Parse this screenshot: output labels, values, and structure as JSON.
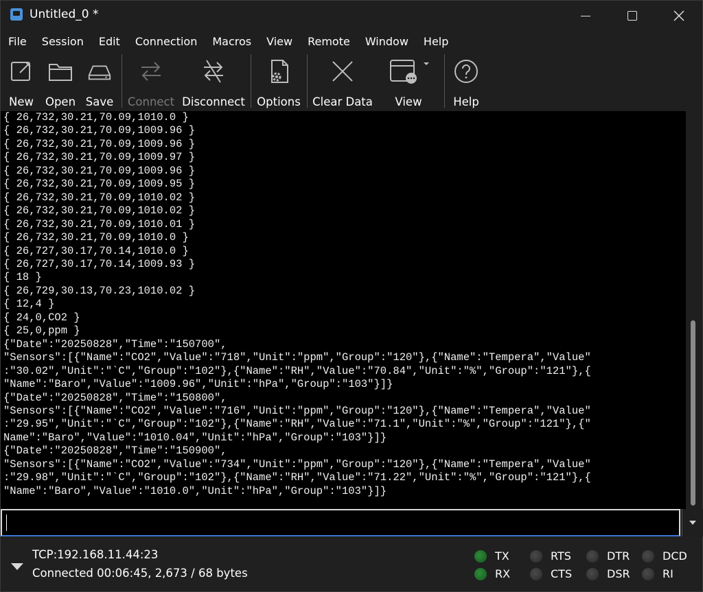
{
  "window": {
    "title": "Untitled_0 *"
  },
  "menu": [
    "File",
    "Session",
    "Edit",
    "Connection",
    "Macros",
    "View",
    "Remote",
    "Window",
    "Help"
  ],
  "toolbar": {
    "new": "New",
    "open": "Open",
    "save": "Save",
    "connect": "Connect",
    "disconnect": "Disconnect",
    "options": "Options",
    "clear": "Clear Data",
    "view": "View",
    "help": "Help"
  },
  "terminal": {
    "lines": [
      "{ 26,732,30.21,70.09,1010.0 }",
      "{ 26,732,30.21,70.09,1009.96 }",
      "{ 26,732,30.21,70.09,1009.96 }",
      "{ 26,732,30.21,70.09,1009.97 }",
      "{ 26,732,30.21,70.09,1009.96 }",
      "{ 26,732,30.21,70.09,1009.95 }",
      "{ 26,732,30.21,70.09,1010.02 }",
      "{ 26,732,30.21,70.09,1010.02 }",
      "{ 26,732,30.21,70.09,1010.01 }",
      "{ 26,732,30.21,70.09,1010.0 }",
      "{ 26,727,30.17,70.14,1010.0 }",
      "{ 26,727,30.17,70.14,1009.93 }",
      "{ 18 }",
      "{ 26,729,30.13,70.23,1010.02 }",
      "{ 12,4 }",
      "{ 24,0,CO2 }",
      "{ 25,0,ppm }",
      "{\"Date\":\"20250828\",\"Time\":\"150700\",",
      "\"Sensors\":[{\"Name\":\"CO2\",\"Value\":\"718\",\"Unit\":\"ppm\",\"Group\":\"120\"},{\"Name\":\"Tempera\",\"Value\"",
      ":\"30.02\",\"Unit\":\"`C\",\"Group\":\"102\"},{\"Name\":\"RH\",\"Value\":\"70.84\",\"Unit\":\"%\",\"Group\":\"121\"},{",
      "\"Name\":\"Baro\",\"Value\":\"1009.96\",\"Unit\":\"hPa\",\"Group\":\"103\"}]}",
      "{\"Date\":\"20250828\",\"Time\":\"150800\",",
      "\"Sensors\":[{\"Name\":\"CO2\",\"Value\":\"716\",\"Unit\":\"ppm\",\"Group\":\"120\"},{\"Name\":\"Tempera\",\"Value\"",
      ":\"29.95\",\"Unit\":\"`C\",\"Group\":\"102\"},{\"Name\":\"RH\",\"Value\":\"71.1\",\"Unit\":\"%\",\"Group\":\"121\"},{\"",
      "Name\":\"Baro\",\"Value\":\"1010.04\",\"Unit\":\"hPa\",\"Group\":\"103\"}]}",
      "{\"Date\":\"20250828\",\"Time\":\"150900\",",
      "\"Sensors\":[{\"Name\":\"CO2\",\"Value\":\"734\",\"Unit\":\"ppm\",\"Group\":\"120\"},{\"Name\":\"Tempera\",\"Value\"",
      ":\"29.98\",\"Unit\":\"`C\",\"Group\":\"102\"},{\"Name\":\"RH\",\"Value\":\"71.22\",\"Unit\":\"%\",\"Group\":\"121\"},{",
      "\"Name\":\"Baro\",\"Value\":\"1010.0\",\"Unit\":\"hPa\",\"Group\":\"103\"}]}"
    ]
  },
  "input": {
    "value": ""
  },
  "status": {
    "connection": "TCP:192.168.11.44:23",
    "detail": "Connected 00:06:45, 2,673 / 68 bytes",
    "signals": [
      {
        "label": "TX",
        "on": true
      },
      {
        "label": "RX",
        "on": true
      },
      {
        "label": "RTS",
        "on": false
      },
      {
        "label": "CTS",
        "on": false
      },
      {
        "label": "DTR",
        "on": false
      },
      {
        "label": "DSR",
        "on": false
      },
      {
        "label": "DCD",
        "on": false
      },
      {
        "label": "RI",
        "on": false
      }
    ]
  },
  "colors": {
    "accent": "#3a78d8",
    "led_on": "#2f8a3a",
    "led_off": "#3a3a3a",
    "background": "#1f1f1f",
    "terminal_bg": "#000000"
  },
  "icons": [
    "app-icon",
    "new-icon",
    "open-icon",
    "save-icon",
    "connect-icon",
    "disconnect-icon",
    "options-icon",
    "clear-icon",
    "view-icon",
    "help-icon",
    "chevron-down-icon"
  ]
}
